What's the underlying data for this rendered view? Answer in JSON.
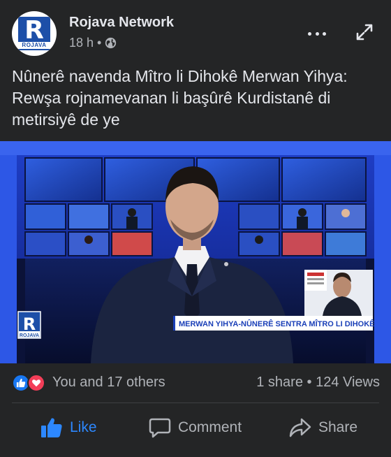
{
  "post": {
    "page_name": "Rojava Network",
    "time": "18 h",
    "separator": "•",
    "privacy_icon": "globe-icon",
    "caption": "Nûnerê navenda Mîtro li Dihokê Merwan Yihya: Rewşa rojnamevanan li başûrê Kurdistanê di metirsiyê de ye"
  },
  "avatar": {
    "letter": "R",
    "word": "ROJAVA"
  },
  "media": {
    "lower_third": "MERWAN YIHYA-NÛNERÊ SENTRA MÎTRO LI DIHOKÊ",
    "logo_letter": "R",
    "logo_word": "ROJAVA"
  },
  "reactions": {
    "icons": [
      "like-icon",
      "love-icon"
    ],
    "text": "You and 17 others",
    "stats": "1 share • 124 Views"
  },
  "actions": {
    "like": "Like",
    "comment": "Comment",
    "share": "Share"
  },
  "colors": {
    "background": "#242526",
    "like_blue": "#2d88ff",
    "love_red": "#f33e58",
    "text_primary": "#e4e6eb",
    "text_secondary": "#b0b3b8",
    "studio_blue": "#1a2f9a"
  }
}
